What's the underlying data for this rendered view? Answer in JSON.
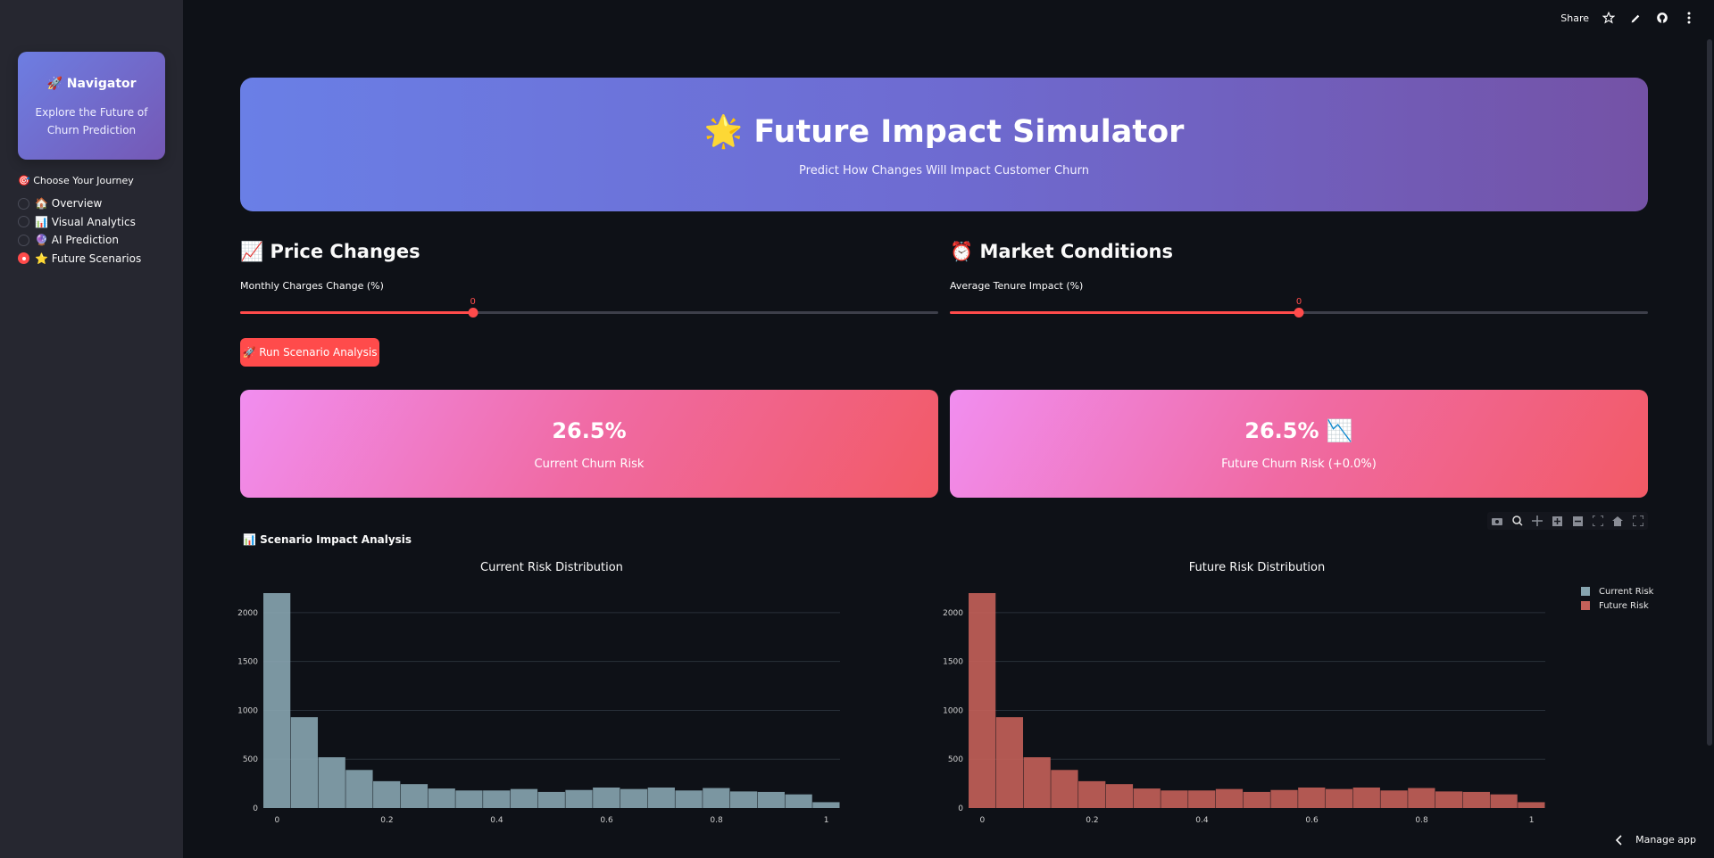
{
  "sidebar": {
    "nav_title": "🚀 Navigator",
    "nav_subtitle": "Explore the Future of Churn Prediction",
    "journey_label": "🎯 Choose Your Journey",
    "items": [
      {
        "label": "🏠 Overview",
        "selected": false
      },
      {
        "label": "📊 Visual Analytics",
        "selected": false
      },
      {
        "label": "🔮 AI Prediction",
        "selected": false
      },
      {
        "label": "⭐ Future Scenarios",
        "selected": true
      }
    ]
  },
  "topbar": {
    "share_label": "Share",
    "icons": [
      "star-icon",
      "edit-icon",
      "github-icon",
      "more-icon"
    ]
  },
  "hero": {
    "title": "🌟 Future Impact Simulator",
    "subtitle": "Predict How Changes Will Impact Customer Churn"
  },
  "price": {
    "header": "📈 Price Changes",
    "slider_label": "Monthly Charges Change (%)",
    "value": "0",
    "min": -50,
    "max": 100,
    "current": 0
  },
  "market": {
    "header": "⏰ Market Conditions",
    "slider_label": "Average Tenure Impact (%)",
    "value": "0",
    "min": -50,
    "max": 50,
    "current": 0
  },
  "run_button_label": "🚀 Run Scenario Analysis",
  "metrics": {
    "current": {
      "value": "26.5%",
      "label": "Current Churn Risk"
    },
    "future": {
      "value": "26.5% 📉",
      "label": "Future Churn Risk (+0.0%)"
    }
  },
  "chart_section_title": "📊 Scenario Impact Analysis",
  "manage_app_label": "Manage app",
  "colors": {
    "accent": "#ff4b4b",
    "current_series": "#87a5b0",
    "future_series": "#c46059"
  },
  "chart_data": [
    {
      "type": "bar",
      "title": "Current Risk Distribution",
      "xlabel": "",
      "ylabel": "",
      "bin_edges": [
        -0.025,
        0.025,
        0.075,
        0.125,
        0.175,
        0.225,
        0.275,
        0.325,
        0.375,
        0.425,
        0.475,
        0.525,
        0.575,
        0.625,
        0.675,
        0.725,
        0.775,
        0.825,
        0.875,
        0.925,
        0.975,
        1.025
      ],
      "series": [
        {
          "name": "Current Risk",
          "values": [
            2200,
            930,
            520,
            390,
            275,
            245,
            200,
            180,
            180,
            195,
            165,
            185,
            210,
            195,
            210,
            180,
            205,
            170,
            165,
            140,
            60
          ]
        }
      ],
      "xlim": [
        -0.025,
        1.025
      ],
      "ylim": [
        0,
        2200
      ],
      "xticks": [
        0,
        0.2,
        0.4,
        0.6,
        0.8,
        1
      ],
      "xtick_labels": [
        "0",
        "0.2",
        "0.4",
        "0.6",
        "0.8",
        "1"
      ],
      "yticks": [
        0,
        500,
        1000,
        1500,
        2000
      ],
      "grid": true,
      "legend": "top-right"
    },
    {
      "type": "bar",
      "title": "Future Risk Distribution",
      "xlabel": "",
      "ylabel": "",
      "bin_edges": [
        -0.025,
        0.025,
        0.075,
        0.125,
        0.175,
        0.225,
        0.275,
        0.325,
        0.375,
        0.425,
        0.475,
        0.525,
        0.575,
        0.625,
        0.675,
        0.725,
        0.775,
        0.825,
        0.875,
        0.925,
        0.975,
        1.025
      ],
      "series": [
        {
          "name": "Future Risk",
          "values": [
            2200,
            930,
            520,
            390,
            275,
            245,
            200,
            180,
            180,
            195,
            165,
            185,
            210,
            195,
            210,
            180,
            205,
            170,
            165,
            140,
            60
          ]
        }
      ],
      "xlim": [
        -0.025,
        1.025
      ],
      "ylim": [
        0,
        2200
      ],
      "xticks": [
        0,
        0.2,
        0.4,
        0.6,
        0.8,
        1
      ],
      "xtick_labels": [
        "0",
        "0.2",
        "0.4",
        "0.6",
        "0.8",
        "1"
      ],
      "yticks": [
        0,
        500,
        1000,
        1500,
        2000
      ],
      "grid": true,
      "legend": "top-right"
    }
  ]
}
